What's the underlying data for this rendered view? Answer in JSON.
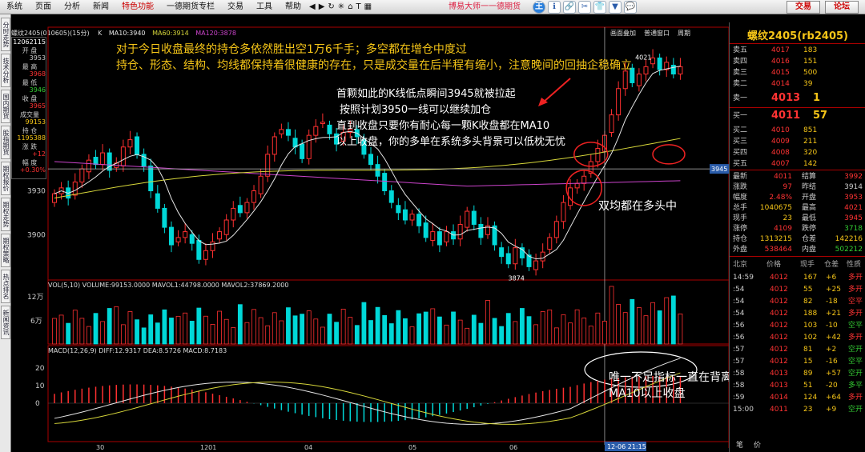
{
  "menu": [
    {
      "label": "系统"
    },
    {
      "label": "页面"
    },
    {
      "label": "分析"
    },
    {
      "label": "新闻"
    },
    {
      "label": "特色功能",
      "active": true
    },
    {
      "label": "一德期货专栏"
    },
    {
      "label": "交易"
    },
    {
      "label": "工具"
    },
    {
      "label": "帮助"
    }
  ],
  "brand": "博易大师一一德期货",
  "tools": [
    "王",
    "ℹ",
    "🔗",
    "✂",
    "👕",
    "▼",
    "💬"
  ],
  "trade_btn": "交易",
  "forum_btn": "论坛",
  "left_tabs": [
    "分时走势",
    "技术分析",
    "国内期货",
    "股指期货",
    "期权报价",
    "期权走势",
    "期权策略",
    "热点排名",
    "新闻资讯"
  ],
  "header": {
    "instrument": "螺纹2405(010605)(15分)",
    "ma_prefix": "K",
    "ma10": "MA10:3940",
    "ma60": "MA60:3914",
    "ma120": "MA120:3878",
    "links": [
      "画面叠加",
      "普通窗口",
      "周期"
    ]
  },
  "summary_box": {
    "date": "12062115",
    "items": [
      {
        "label": "开 盘",
        "value": "3953",
        "color": "#ccc"
      },
      {
        "label": "最 高",
        "value": "3968",
        "color": "#f33"
      },
      {
        "label": "最 低",
        "value": "3946",
        "color": "#3c3"
      },
      {
        "label": "收 盘",
        "value": "3965",
        "color": "#f33"
      },
      {
        "label": "成交量",
        "value": "99153",
        "color": "#f5c518"
      },
      {
        "label": "持 仓",
        "value": "1195388",
        "color": "#f5c518"
      },
      {
        "label": "涨 跌",
        "value": "+12",
        "color": "#f33"
      },
      {
        "label": "幅 度",
        "value": "+0.30%",
        "color": "#f33"
      }
    ]
  },
  "annotations": {
    "top": [
      "对于今日收盘最终的持仓多依然胜出空1万6千手；多空都在增仓中度过",
      "持仓、形态、结构、均线都保持着很健康的存在，只是成交量在后半程有缩小，注意晚间的回抽企稳确立"
    ],
    "middle": [
      "首颗如此的K线低点瞬间3945就被拉起",
      "按照计划3950一线可以继续加仓",
      "直到收盘只要你有耐心每一颗K收盘都在MA10",
      "以上收盘，你的多单在系统多头背景可以低枕无忧"
    ],
    "ma_note": "双均都在多头中",
    "macd_note": [
      "唯一不足指标一直在背离中但价格一直在保持在",
      "MA10以上收盘"
    ]
  },
  "price_labels": {
    "high": "4021",
    "low": "3874",
    "cursor": "3945",
    "y_axis": [
      "3930",
      "3900"
    ]
  },
  "volume": {
    "header": "VOL(5,10) VOLUME:99153.0000 MAVOL1:44798.0000 MAVOL2:37869.2000",
    "y_axis": [
      "12万",
      "6万"
    ]
  },
  "macd": {
    "header": "MACD(12,26,9) DIFF:12.9317 DEA:8.5726 MACD:8.7183",
    "y_axis": [
      "20",
      "10",
      "0"
    ]
  },
  "x_axis": [
    "30",
    "1201",
    "04",
    "05",
    "06"
  ],
  "cursor_time": "12-06 21:15",
  "colors": {
    "up": "#ff3030",
    "down": "#00d8d8",
    "ma10": "#e6e6e6",
    "ma60": "#d6d63a",
    "ma120": "#cc44cc",
    "accent": "#f5c518"
  },
  "chart_data": {
    "type": "candlestick",
    "title": "螺纹2405(010605)(15分)",
    "ylim": [
      3870,
      4030
    ],
    "closes": [
      3928,
      3932,
      3925,
      3936,
      3945,
      3951,
      3948,
      3956,
      3944,
      3949,
      3960,
      3965,
      3955,
      3947,
      3930,
      3918,
      3905,
      3893,
      3898,
      3902,
      3894,
      3883,
      3889,
      3895,
      3902,
      3910,
      3918,
      3915,
      3922,
      3930,
      3940,
      3955,
      3967,
      3972,
      3968,
      3960,
      3952,
      3968,
      3974,
      3977,
      3969,
      3962,
      3970,
      3972,
      3967,
      3955,
      3948,
      3940,
      3930,
      3922,
      3915,
      3910,
      3914,
      3906,
      3898,
      3902,
      3893,
      3902,
      3897,
      3907,
      3916,
      3907,
      3898,
      3906,
      3893,
      3885,
      3880,
      3891,
      3884,
      3878,
      3882,
      3888,
      3898,
      3909,
      3922,
      3932,
      3935,
      3940,
      3950,
      3959,
      3968,
      3982,
      4000,
      4012,
      4004,
      4010,
      4015,
      4021,
      4013,
      4018,
      4010,
      4015
    ]
  },
  "quote": {
    "title": "螺纹2405(rb2405)",
    "asks": [
      {
        "label": "卖五",
        "price": "4017",
        "vol": "183"
      },
      {
        "label": "卖四",
        "price": "4016",
        "vol": "151"
      },
      {
        "label": "卖三",
        "price": "4015",
        "vol": "500"
      },
      {
        "label": "卖二",
        "price": "4014",
        "vol": "39"
      }
    ],
    "ask1": {
      "label": "卖一",
      "price": "4013",
      "vol": "1"
    },
    "bid1": {
      "label": "买一",
      "price": "4011",
      "vol": "57"
    },
    "bids": [
      {
        "label": "买二",
        "price": "4010",
        "vol": "851"
      },
      {
        "label": "买三",
        "price": "4009",
        "vol": "211"
      },
      {
        "label": "买四",
        "price": "4008",
        "vol": "320"
      },
      {
        "label": "买五",
        "price": "4007",
        "vol": "142"
      }
    ],
    "stats": [
      {
        "l1": "最新",
        "v1": "4011",
        "c1": "#f33",
        "l2": "结算",
        "v2": "3992",
        "c2": "#f33"
      },
      {
        "l1": "涨跌",
        "v1": "97",
        "c1": "#f33",
        "l2": "昨结",
        "v2": "3914",
        "c2": "#ccc"
      },
      {
        "l1": "幅度",
        "v1": "2.48%",
        "c1": "#f33",
        "l2": "开盘",
        "v2": "3953",
        "c2": "#f33"
      },
      {
        "l1": "总手",
        "v1": "1040675",
        "c1": "#f5c518",
        "l2": "最高",
        "v2": "4021",
        "c2": "#f33"
      },
      {
        "l1": "现手",
        "v1": "23",
        "c1": "#f5c518",
        "l2": "最低",
        "v2": "3945",
        "c2": "#f33"
      },
      {
        "l1": "涨停",
        "v1": "4109",
        "c1": "#f33",
        "l2": "跌停",
        "v2": "3718",
        "c2": "#3c3"
      },
      {
        "l1": "持仓",
        "v1": "1313215",
        "c1": "#f5c518",
        "l2": "仓差",
        "v2": "142216",
        "c2": "#f5c518"
      },
      {
        "l1": "外盘",
        "v1": "538464",
        "c1": "#f33",
        "l2": "内盘",
        "v2": "502212",
        "c2": "#3c3"
      }
    ],
    "ticks_header": [
      "北京",
      "价格",
      "现手",
      "仓差",
      "性质"
    ],
    "ticks": [
      {
        "t": "14:59",
        "p": "4012",
        "v": "167",
        "d": "+6",
        "n": "多开",
        "nc": "#f33"
      },
      {
        "t": ":54",
        "p": "4012",
        "v": "55",
        "d": "+25",
        "n": "多开",
        "nc": "#f33"
      },
      {
        "t": ":54",
        "p": "4012",
        "v": "82",
        "d": "-18",
        "n": "空平",
        "nc": "#f33"
      },
      {
        "t": ":54",
        "p": "4012",
        "v": "188",
        "d": "+21",
        "n": "多开",
        "nc": "#f33"
      },
      {
        "t": ":56",
        "p": "4012",
        "v": "103",
        "d": "-10",
        "n": "空平",
        "nc": "#3c3"
      },
      {
        "t": ":56",
        "p": "4012",
        "v": "102",
        "d": "+42",
        "n": "多开",
        "nc": "#f33"
      },
      {
        "t": ":57",
        "p": "4012",
        "v": "81",
        "d": "+2",
        "n": "空开",
        "nc": "#3c3"
      },
      {
        "t": ":57",
        "p": "4012",
        "v": "15",
        "d": "-16",
        "n": "空平",
        "nc": "#3c3"
      },
      {
        "t": ":58",
        "p": "4013",
        "v": "89",
        "d": "+57",
        "n": "空开",
        "nc": "#3c3"
      },
      {
        "t": ":58",
        "p": "4013",
        "v": "51",
        "d": "-20",
        "n": "多平",
        "nc": "#3c3"
      },
      {
        "t": ":59",
        "p": "4014",
        "v": "124",
        "d": "+64",
        "n": "多开",
        "nc": "#f33"
      },
      {
        "t": "15:00",
        "p": "4011",
        "v": "23",
        "d": "+9",
        "n": "空开",
        "nc": "#3c3"
      }
    ],
    "bottom_tabs": [
      "笔",
      "价"
    ]
  }
}
